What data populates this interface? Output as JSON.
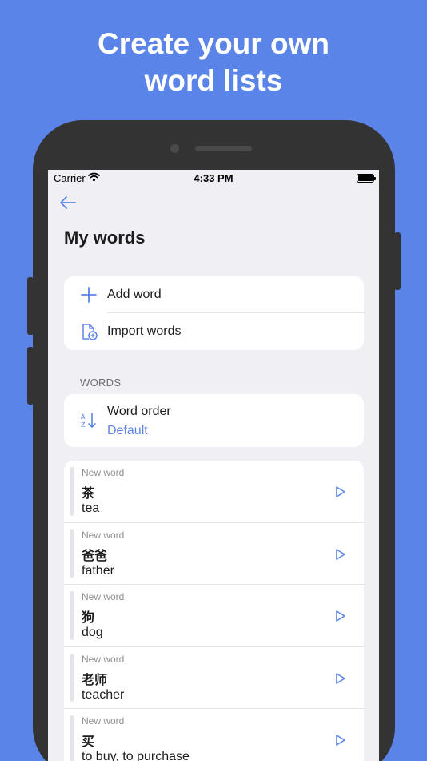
{
  "headline": {
    "line1": "Create your own",
    "line2": "word lists"
  },
  "statusbar": {
    "carrier": "Carrier",
    "time": "4:33 PM"
  },
  "page": {
    "title": "My words"
  },
  "actions": {
    "add_label": "Add word",
    "import_label": "Import words"
  },
  "words_section": {
    "header": "WORDS",
    "order_label": "Word order",
    "order_value": "Default"
  },
  "words": [
    {
      "status": "New word",
      "hanzi": "茶",
      "meaning": "tea"
    },
    {
      "status": "New word",
      "hanzi": "爸爸",
      "meaning": "father"
    },
    {
      "status": "New word",
      "hanzi": "狗",
      "meaning": "dog"
    },
    {
      "status": "New word",
      "hanzi": "老师",
      "meaning": "teacher"
    },
    {
      "status": "New word",
      "hanzi": "买",
      "meaning": "to buy, to purchase"
    }
  ],
  "colors": {
    "accent": "#5b84e8",
    "background": "#efeff4",
    "phone": "#333333"
  },
  "icons": {
    "back": "arrow-left-icon",
    "add": "plus-icon",
    "import": "document-plus-icon",
    "order": "sort-az-icon",
    "play": "play-icon"
  }
}
